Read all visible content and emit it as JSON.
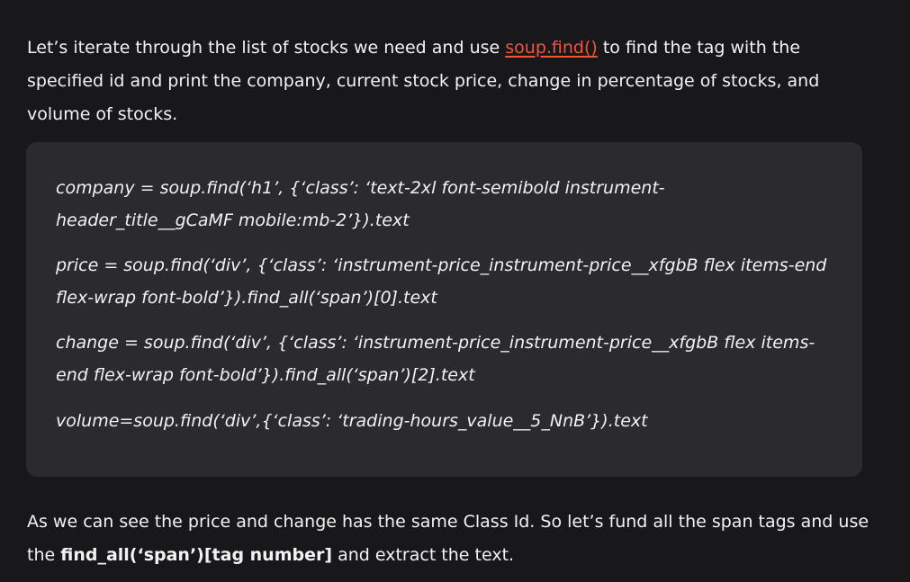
{
  "intro": {
    "before_link": "Let’s iterate through the list of stocks we need and use ",
    "link_text": "soup.find()",
    "after_link": " to find the tag with the specified id and print the company, current stock price, change in percentage of stocks, and volume of stocks."
  },
  "code_lines": [
    "company = soup.find(‘h1’, {‘class’: ‘text-2xl font-semibold instrument-header_title__gCaMF mobile:mb-2’}).text",
    "price = soup.find(‘div’, {‘class’: ‘instrument-price_instrument-price__xfgbB flex items-end flex-wrap font-bold’}).find_all(‘span’)[0].text",
    "change = soup.find(‘div’, {‘class’: ‘instrument-price_instrument-price__xfgbB flex items-end flex-wrap font-bold’}).find_all(‘span’)[2].text",
    "volume=soup.find(‘div’,{‘class’: ‘trading-hours_value__5_NnB’}).text"
  ],
  "outro": {
    "before_bold": "As we can see the price and change has the same Class Id. So let’s fund all the span tags and use the ",
    "bold_text": "find_all(‘span’)[tag number]",
    "after_bold": " and extract the text."
  }
}
